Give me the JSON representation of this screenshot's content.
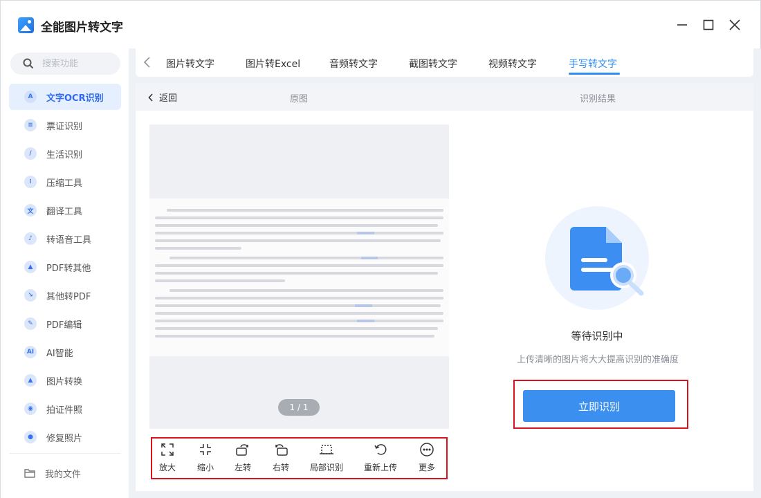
{
  "app": {
    "title": "全能图片转文字"
  },
  "sidebar": {
    "search_placeholder": "搜索功能",
    "items": [
      {
        "label": "文字OCR识别",
        "icon": "ocr-icon",
        "glyph": "A",
        "active": true
      },
      {
        "label": "票证识别",
        "icon": "ticket-icon",
        "glyph": "≡"
      },
      {
        "label": "生活识别",
        "icon": "pen-icon",
        "glyph": "/"
      },
      {
        "label": "压缩工具",
        "icon": "compress-icon",
        "glyph": "⁝"
      },
      {
        "label": "翻译工具",
        "icon": "translate-icon",
        "glyph": "文"
      },
      {
        "label": "转语音工具",
        "icon": "music-icon",
        "glyph": "♪"
      },
      {
        "label": "PDF转其他",
        "icon": "pdf-convert-icon",
        "glyph": "▲"
      },
      {
        "label": "其他转PDF",
        "icon": "to-pdf-icon",
        "glyph": "↘"
      },
      {
        "label": "PDF编辑",
        "icon": "pdf-edit-icon",
        "glyph": "✎"
      },
      {
        "label": "AI智能",
        "icon": "ai-icon",
        "glyph": "AI"
      },
      {
        "label": "图片转换",
        "icon": "image-icon",
        "glyph": "▲"
      },
      {
        "label": "拍证件照",
        "icon": "camera-icon",
        "glyph": "◉"
      },
      {
        "label": "修复照片",
        "icon": "person-icon",
        "glyph": "●"
      }
    ],
    "files_label": "我的文件"
  },
  "tabs": [
    {
      "label": "图片转文字"
    },
    {
      "label": "图片转Excel"
    },
    {
      "label": "音频转文字"
    },
    {
      "label": "截图转文字"
    },
    {
      "label": "视频转文字"
    },
    {
      "label": "手写转文字",
      "active": true
    }
  ],
  "panel": {
    "back_label": "返回",
    "original_label": "原图",
    "result_label": "识别结果",
    "page_indicator": "1 / 1"
  },
  "toolbar": [
    {
      "label": "放大",
      "icon": "zoom-in-icon"
    },
    {
      "label": "缩小",
      "icon": "zoom-out-icon"
    },
    {
      "label": "左转",
      "icon": "rotate-left-icon"
    },
    {
      "label": "右转",
      "icon": "rotate-right-icon"
    },
    {
      "label": "局部识别",
      "icon": "crop-icon"
    },
    {
      "label": "重新上传",
      "icon": "reupload-icon"
    },
    {
      "label": "更多",
      "icon": "more-icon"
    }
  ],
  "result": {
    "status": "等待识别中",
    "hint": "上传清晰的图片将大大提高识别的准确度",
    "button": "立即识别"
  },
  "colors": {
    "accent": "#2f8cf0",
    "primary_button": "#3b8fee",
    "highlight_border": "#d9121e",
    "active_nav_bg": "#e6effd"
  }
}
